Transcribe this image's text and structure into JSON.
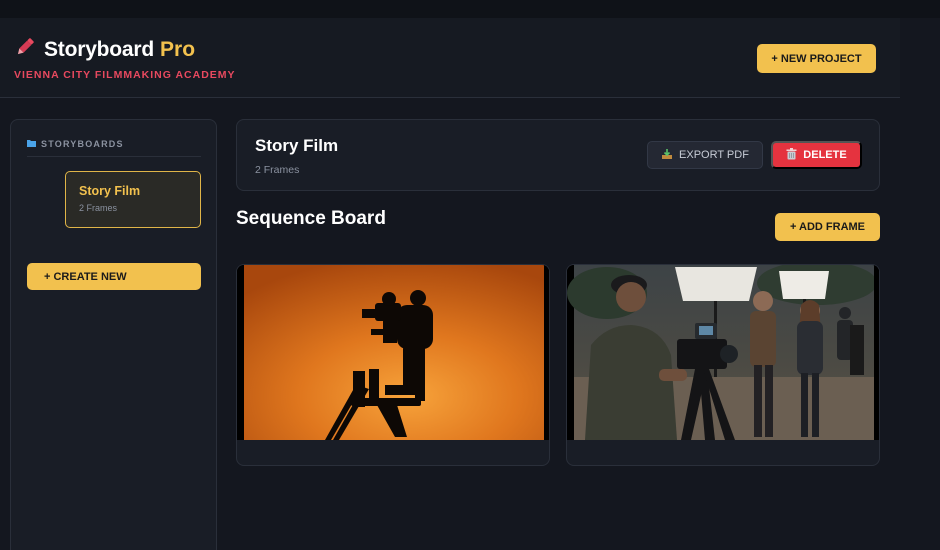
{
  "header": {
    "title": "Storyboard",
    "title_accent": "Pro",
    "subtitle": "VIENNA CITY FILMMAKING ACADEMY",
    "new_project_label": "+ NEW PROJECT"
  },
  "sidebar": {
    "heading": "STORYBOARDS",
    "items": [
      {
        "title": "Story Film",
        "frames": "2 Frames"
      }
    ],
    "create_label": "+ CREATE NEW"
  },
  "project": {
    "title": "Story Film",
    "frames": "2 Frames",
    "export_label": "EXPORT PDF",
    "delete_label": "DELETE"
  },
  "board": {
    "title": "Sequence Board",
    "add_frame_label": "+ ADD FRAME",
    "frames": [
      {
        "scene": "camera-crane-silhouette-sunset"
      },
      {
        "scene": "film-set-crew-with-camera"
      }
    ]
  },
  "colors": {
    "accent": "#f2c14e",
    "danger": "#e5333f",
    "brand_red": "#e8495f",
    "background": "#14171f"
  },
  "icons": {
    "brand": "pencil-icon",
    "folder": "folder-icon",
    "export": "download-tray-icon",
    "delete": "trash-icon"
  }
}
